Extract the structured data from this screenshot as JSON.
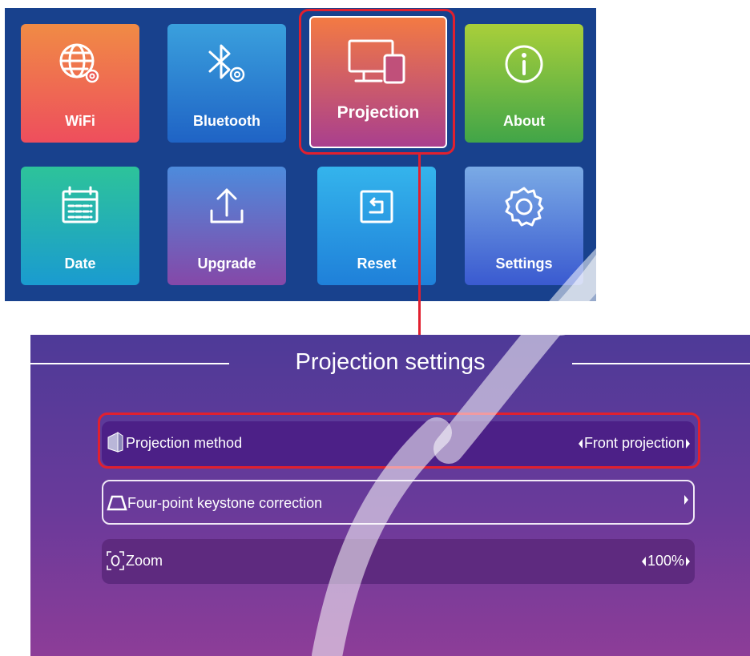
{
  "menu": {
    "tiles": [
      {
        "label": "WiFi",
        "icon": "globe-settings-icon"
      },
      {
        "label": "Bluetooth",
        "icon": "bluetooth-settings-icon"
      },
      {
        "label": "Projection",
        "icon": "monitor-phone-icon"
      },
      {
        "label": "About",
        "icon": "info-icon"
      },
      {
        "label": "Date",
        "icon": "calendar-icon"
      },
      {
        "label": "Upgrade",
        "icon": "upload-icon"
      },
      {
        "label": "Reset",
        "icon": "reset-icon"
      },
      {
        "label": "Settings",
        "icon": "gear-icon"
      }
    ],
    "selected": "Projection"
  },
  "projection_settings": {
    "title": "Projection settings",
    "rows": [
      {
        "label": "Projection method",
        "value": "Front projection",
        "icon": "projection-method-icon"
      },
      {
        "label": "Four-point keystone correction",
        "value": "",
        "icon": "keystone-icon"
      },
      {
        "label": "Zoom",
        "value": "100%",
        "icon": "zoom-icon"
      }
    ]
  },
  "colors": {
    "highlight": "#e1202f",
    "menu_background": "#18418d",
    "panel_top": "#4e3a98",
    "panel_bottom": "#8d3d98"
  }
}
